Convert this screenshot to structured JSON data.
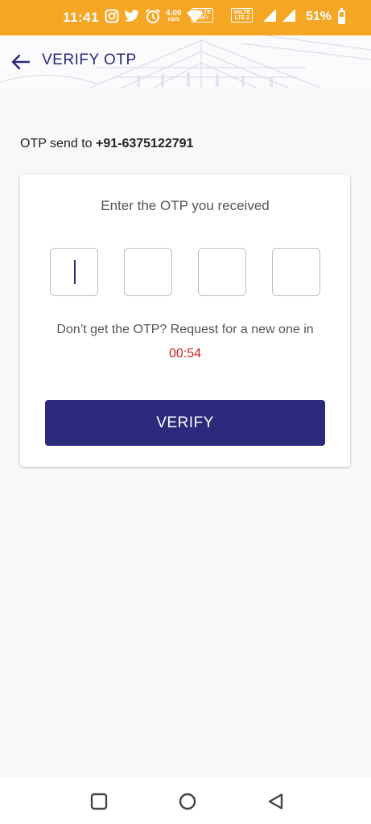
{
  "status_bar": {
    "time": "11:41",
    "speed_value": "4.00",
    "speed_unit": "KB/S",
    "chip_1_top": "VoLTE",
    "chip_1_bottom": "WiFi",
    "chip_2_top": "VoLTE",
    "chip_2_bottom": "LTE 2",
    "battery": "51%",
    "battery_level": 0.51,
    "icons": [
      "instagram-icon",
      "twitter-icon",
      "alarm-icon",
      "wifi-icon",
      "signal-icon",
      "signal-icon",
      "battery-icon"
    ]
  },
  "header": {
    "title": "VERIFY OTP",
    "back_icon": "arrow-left-icon"
  },
  "otp_sent": {
    "prefix": "OTP send to",
    "phone": "+91-6375122791"
  },
  "card": {
    "title": "Enter the OTP you received",
    "resend_text": "Don’t get the OTP? Request for a new one in",
    "timer": "00:54",
    "verify_label": "VERIFY",
    "otp_digits": [
      "",
      "",
      "",
      ""
    ]
  },
  "colors": {
    "status_bar": "#f5a623",
    "primary": "#2c2a7d",
    "timer": "#cc1f1f"
  },
  "navbar": {
    "icons": [
      "recents-square-icon",
      "home-circle-icon",
      "back-triangle-icon"
    ]
  }
}
